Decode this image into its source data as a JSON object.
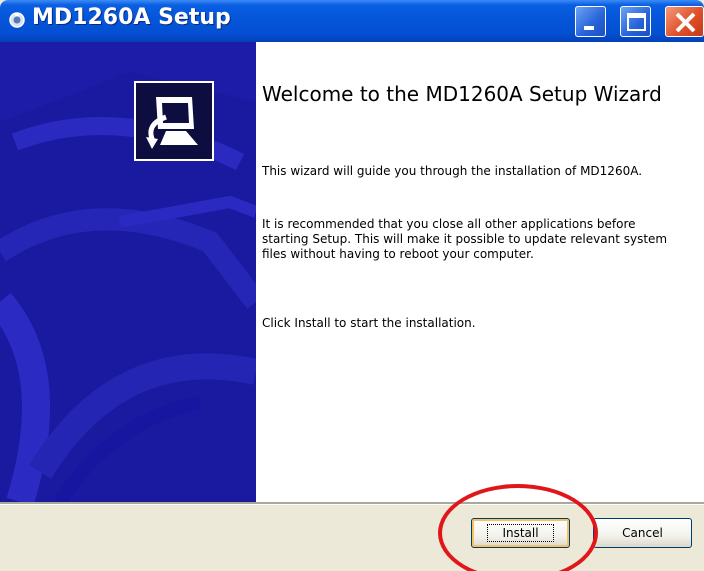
{
  "window": {
    "title": "MD1260A Setup",
    "icon": "installer-icon",
    "controls": [
      "minimize-icon",
      "maximize-icon",
      "close-icon"
    ]
  },
  "sidebar": {
    "logo_icon": "computer-install-icon",
    "background_color": "#1e1eac"
  },
  "content": {
    "heading": "Welcome to the MD1260A Setup Wizard",
    "paragraphs": [
      "This wizard will guide you through the installation of MD1260A.",
      "It is recommended that you close all other applications before starting Setup. This will make it possible to update relevant system files without having to reboot your computer.",
      "Click Install to start the installation."
    ]
  },
  "buttons": {
    "install_label": "Install",
    "cancel_label": "Cancel"
  },
  "annotation": {
    "highlight": "install-button",
    "color": "#e0161b"
  }
}
